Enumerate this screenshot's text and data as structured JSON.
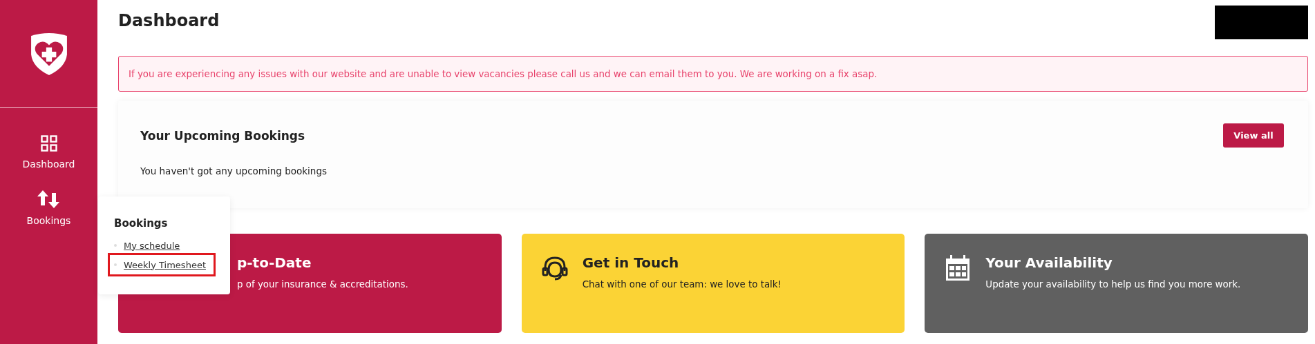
{
  "sidebar": {
    "items": [
      {
        "label": "Dashboard",
        "kind": "grid"
      },
      {
        "label": "Bookings",
        "kind": "arrows"
      }
    ]
  },
  "page": {
    "title": "Dashboard"
  },
  "alert": {
    "text": "If you are experiencing any issues with our website and are unable to view vacancies please call us and we can email them to you. We are working on a fix asap."
  },
  "upcoming": {
    "title": "Your Upcoming Bookings",
    "button": "View all",
    "empty": "You haven't got any upcoming bookings"
  },
  "cards": [
    {
      "kind": "covered",
      "color": "#bc1a46",
      "title": "p-to-Date",
      "text": "p of your insurance & accreditations."
    },
    {
      "kind": "headset",
      "color": "#fbd335",
      "title": "Get in Touch",
      "text": "Chat with one of our team: we love to talk!"
    },
    {
      "kind": "calendar",
      "color": "#606060",
      "title": "Your Availability",
      "text": "Update your availability to help us find you more work."
    }
  ],
  "popup": {
    "title": "Bookings",
    "items": [
      {
        "label": "My schedule",
        "highlighted": false
      },
      {
        "label": "Weekly Timesheet",
        "highlighted": true
      }
    ]
  }
}
